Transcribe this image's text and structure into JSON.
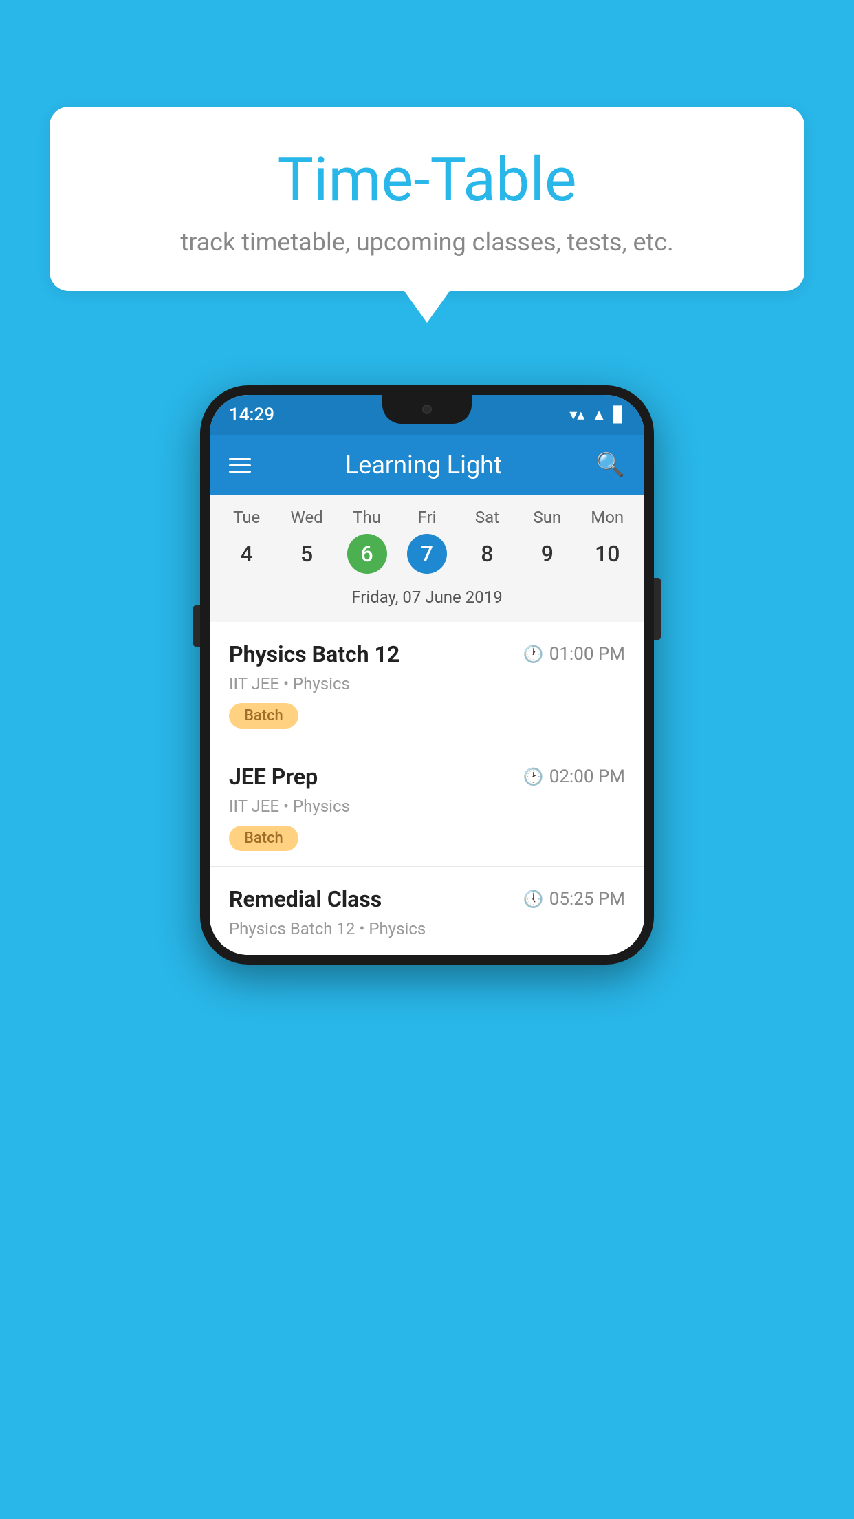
{
  "page": {
    "background_color": "#29b6e8"
  },
  "speech_bubble": {
    "title": "Time-Table",
    "subtitle": "track timetable, upcoming classes, tests, etc."
  },
  "phone": {
    "status_bar": {
      "time": "14:29",
      "wifi_icon": "▼▲",
      "signal_icon": "▲",
      "battery_icon": "▊"
    },
    "app_bar": {
      "title": "Learning Light",
      "menu_label": "menu",
      "search_label": "search"
    },
    "calendar": {
      "days": [
        {
          "label": "Tue",
          "number": "4",
          "state": "normal"
        },
        {
          "label": "Wed",
          "number": "5",
          "state": "normal"
        },
        {
          "label": "Thu",
          "number": "6",
          "state": "today"
        },
        {
          "label": "Fri",
          "number": "7",
          "state": "selected"
        },
        {
          "label": "Sat",
          "number": "8",
          "state": "normal"
        },
        {
          "label": "Sun",
          "number": "9",
          "state": "normal"
        },
        {
          "label": "Mon",
          "number": "10",
          "state": "normal"
        }
      ],
      "selected_date_label": "Friday, 07 June 2019"
    },
    "schedule": [
      {
        "title": "Physics Batch 12",
        "time": "01:00 PM",
        "subtitle": "IIT JEE • Physics",
        "badge": "Batch"
      },
      {
        "title": "JEE Prep",
        "time": "02:00 PM",
        "subtitle": "IIT JEE • Physics",
        "badge": "Batch"
      },
      {
        "title": "Remedial Class",
        "time": "05:25 PM",
        "subtitle": "Physics Batch 12 • Physics",
        "badge": null
      }
    ]
  }
}
